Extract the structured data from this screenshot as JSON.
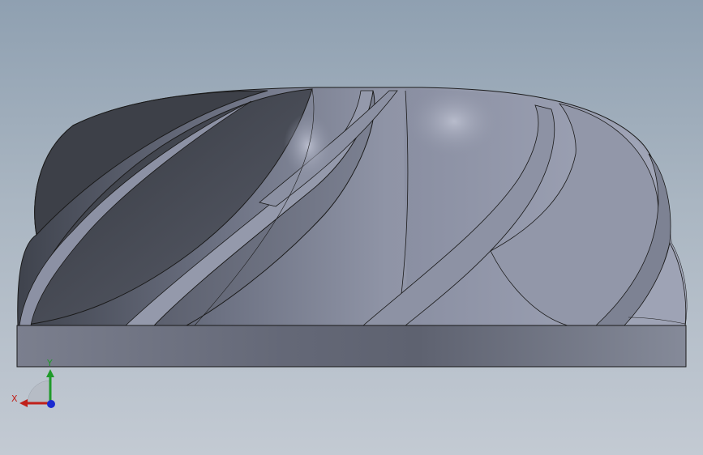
{
  "window": {
    "background_top": "#8fa0b1",
    "background_bottom": "#c3cad3"
  },
  "model": {
    "part": "impeller",
    "body_color": "#8e94a6",
    "dark_shade": "#3c3f47",
    "base_color": "#6f7382",
    "edge_color": "#1a1a1a"
  },
  "triad": {
    "x_label": "X",
    "y_label": "Y",
    "x_color": "#c0201a",
    "y_color": "#1f9a2a",
    "z_color": "#1a2ad0"
  }
}
